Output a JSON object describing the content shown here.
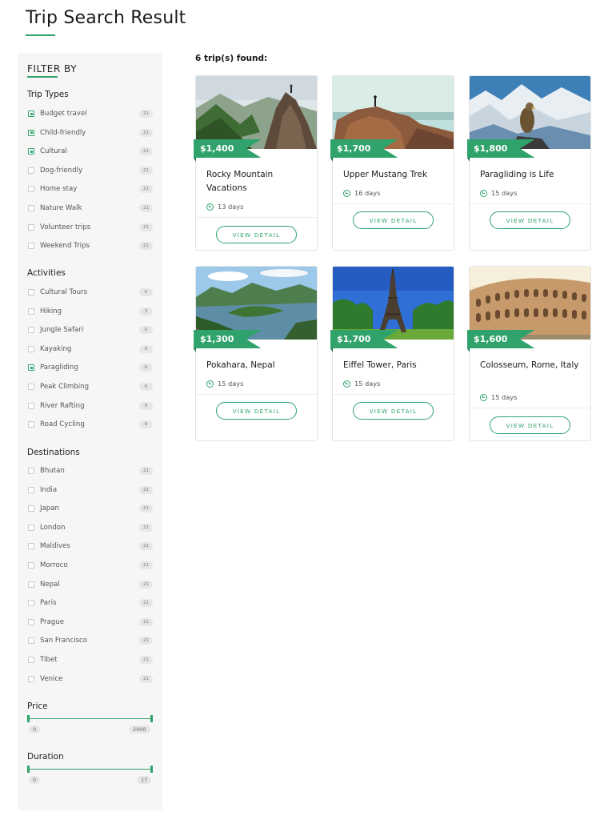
{
  "page": {
    "title": "Trip Search Result"
  },
  "colors": {
    "accent": "#2fa36b",
    "accent_dark": "#1b6f47",
    "sidebar_bg": "#f6f6f6"
  },
  "filters": {
    "heading": "FILTER BY",
    "trip_types": {
      "title": "Trip Types",
      "items": [
        {
          "label": "Budget travel",
          "count": "21",
          "checked": true
        },
        {
          "label": "Child-friendly",
          "count": "21",
          "checked": true
        },
        {
          "label": "Cultural",
          "count": "21",
          "checked": true
        },
        {
          "label": "Dog-friendly",
          "count": "21",
          "checked": false
        },
        {
          "label": "Home stay",
          "count": "21",
          "checked": false
        },
        {
          "label": "Nature Walk",
          "count": "21",
          "checked": false
        },
        {
          "label": "Volunteer trips",
          "count": "21",
          "checked": false
        },
        {
          "label": "Weekend Trips",
          "count": "21",
          "checked": false
        }
      ]
    },
    "activities": {
      "title": "Activities",
      "items": [
        {
          "label": "Cultural Tours",
          "count": "6",
          "checked": false
        },
        {
          "label": "Hiking",
          "count": "3",
          "checked": false
        },
        {
          "label": "Jungle Safari",
          "count": "6",
          "checked": false
        },
        {
          "label": "Kayaking",
          "count": "6",
          "checked": false
        },
        {
          "label": "Paragliding",
          "count": "6",
          "checked": true
        },
        {
          "label": "Peak Climbing",
          "count": "6",
          "checked": false
        },
        {
          "label": "River Rafting",
          "count": "6",
          "checked": false
        },
        {
          "label": "Road Cycling",
          "count": "6",
          "checked": false
        }
      ]
    },
    "destinations": {
      "title": "Destinations",
      "items": [
        {
          "label": "Bhutan",
          "count": "21",
          "checked": false
        },
        {
          "label": "India",
          "count": "21",
          "checked": false
        },
        {
          "label": "Japan",
          "count": "21",
          "checked": false
        },
        {
          "label": "London",
          "count": "21",
          "checked": false
        },
        {
          "label": "Maldives",
          "count": "21",
          "checked": false
        },
        {
          "label": "Morroco",
          "count": "21",
          "checked": false
        },
        {
          "label": "Nepal",
          "count": "21",
          "checked": false
        },
        {
          "label": "Paris",
          "count": "21",
          "checked": false
        },
        {
          "label": "Prague",
          "count": "21",
          "checked": false
        },
        {
          "label": "San Francisco",
          "count": "21",
          "checked": false
        },
        {
          "label": "Tibet",
          "count": "21",
          "checked": false
        },
        {
          "label": "Venice",
          "count": "21",
          "checked": false
        }
      ]
    },
    "price": {
      "title": "Price",
      "min": "0",
      "max": "2000"
    },
    "duration": {
      "title": "Duration",
      "min": "0",
      "max": "17"
    }
  },
  "results": {
    "found_text": "6 trip(s) found:",
    "button_label": "VIEW DETAIL",
    "trips": [
      {
        "name": "Rocky Mountain Vacations",
        "price": "$1,400",
        "duration": "13 days",
        "image": "mountain-hiker-image"
      },
      {
        "name": "Upper Mustang Trek",
        "price": "$1,700",
        "duration": "16 days",
        "image": "cliff-hiker-image"
      },
      {
        "name": "Paragliding is Life",
        "price": "$1,800",
        "duration": "15 days",
        "image": "bird-mountains-image"
      },
      {
        "name": "Pokahara, Nepal",
        "price": "$1,300",
        "duration": "15 days",
        "image": "lake-hills-image"
      },
      {
        "name": "Eiffel Tower, Paris",
        "price": "$1,700",
        "duration": "15 days",
        "image": "eiffel-tower-image"
      },
      {
        "name": "Colosseum, Rome, Italy",
        "price": "$1,600",
        "duration": "15 days",
        "image": "colosseum-image"
      }
    ]
  }
}
